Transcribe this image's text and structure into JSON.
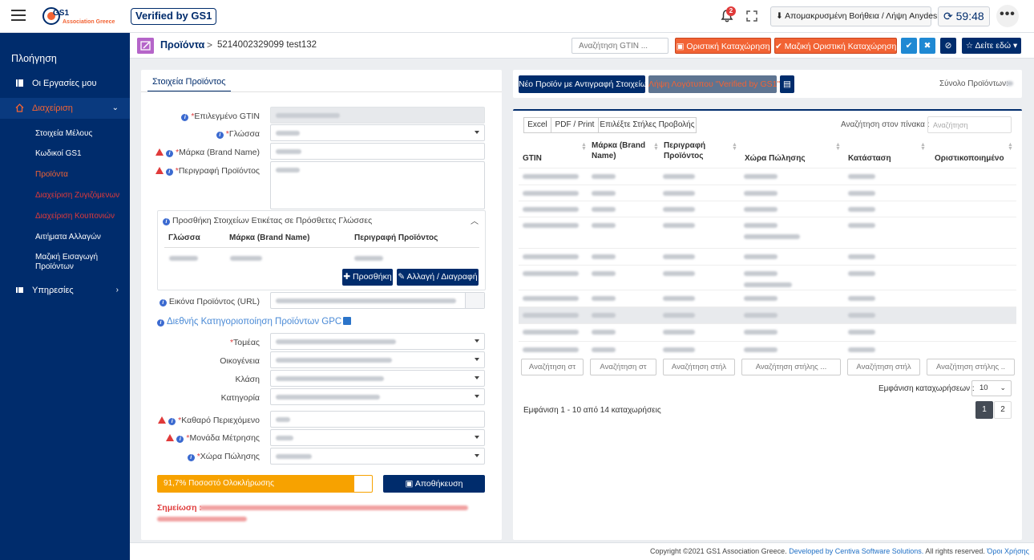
{
  "brand": {
    "logo_text": "GS1",
    "logo_sub": "Association Greece",
    "verified": "Verified by GS1"
  },
  "topbar": {
    "notif_count": "2",
    "remote_label": "Απομακρυσμένη Βοήθεια / Λήψη Anydesk",
    "timer": "59:48",
    "more": "•••"
  },
  "sidebar": {
    "title": "Πλοήγηση",
    "items": [
      {
        "label": "Οι Εργασίες μου"
      },
      {
        "label": "Διαχείριση"
      },
      {
        "label": "Υπηρεσίες"
      }
    ],
    "subitems": [
      {
        "label": "Στοιχεία Μέλους"
      },
      {
        "label": "Κωδικοί GS1"
      },
      {
        "label": "Προϊόντα"
      },
      {
        "label": "Διαχείριση Ζυγιζόμενων"
      },
      {
        "label": "Διαχείριση Κουπονιών"
      },
      {
        "label": "Αιτήματα Αλλαγών"
      },
      {
        "label": "Μαζική Εισαγωγή Προϊόντων"
      }
    ]
  },
  "header": {
    "title": "Προϊόντα",
    "crumb": "5214002329099 test132",
    "gtin_placeholder": "Αναζήτηση GTIN ...",
    "btn_final": "Οριστική Καταχώρηση",
    "btn_mass_final": "Μαζική Οριστική Καταχώρηση",
    "btn_see": "Δείτε εδώ"
  },
  "form": {
    "tab": "Στοιχεία Προϊόντος",
    "gtin_label": "Επιλεγμένο GTIN",
    "lang_label": "Γλώσσα",
    "brand_label": "Μάρκα (Brand Name)",
    "desc_label": "Περιγραφή Προϊόντος",
    "extra_title": "Προσθήκη Στοιχείων Ετικέτας σε Πρόσθετες Γλώσσες",
    "col_lang": "Γλώσσα",
    "col_brand": "Μάρκα (Brand Name)",
    "col_desc": "Περιγραφή Προϊόντος",
    "btn_add": "Προσθήκη",
    "btn_edit": "Αλλαγή / Διαγραφή",
    "image_label": "Εικόνα Προϊόντος (URL)",
    "gpc_title": "Διεθνής Κατηγοριοποίηση Προϊόντων GPC",
    "sector_label": "Τομέας",
    "family_label": "Οικογένεια",
    "class_label": "Κλάση",
    "category_label": "Κατηγορία",
    "net_label": "Καθαρό Περιεχόμενο",
    "unit_label": "Μονάδα Μέτρησης",
    "country_label": "Χώρα Πώλησης",
    "progress_text": "91,7% Ποσοστό Ολοκλήρωσης",
    "progress_value": 91.7,
    "save": "Αποθήκευση",
    "note_label": "Σημείωση :"
  },
  "right": {
    "btn_copy": "Νέο Προϊόν με Αντιγραφή Στοιχείων",
    "btn_logo": "Λήψη Λογότυπου \"Verified by GS1\"",
    "total_label": "Σύνολο Προϊόντων:",
    "excel": "Excel",
    "pdf": "PDF / Print",
    "cols_btn": "Επιλέξτε Στήλες Προβολής",
    "search_label": "Αναζήτηση στον πίνακα :",
    "search_placeholder": "Αναζήτηση",
    "headers": [
      "GTIN",
      "Μάρκα (Brand Name)",
      "Περιγραφή Προϊόντος",
      "Χώρα Πώλησης",
      "Κατάσταση",
      "Οριστικοποιημένο"
    ],
    "col_search": [
      "Αναζήτηση στ",
      "Αναζήτηση στ",
      "Αναζήτηση στήλ",
      "Αναζήτηση στήλης ...",
      "Αναζήτηση στήλ",
      "Αναζήτηση στήλης .."
    ],
    "entries_label": "Εμφάνιση καταχωρήσεων :",
    "entries_value": "10",
    "info": "Εμφάνιση 1 - 10 από 14 καταχωρήσεις",
    "pages": [
      "1",
      "2"
    ]
  },
  "footer": {
    "copyright": "Copyright ©2021 GS1 Association Greece.",
    "dev": "Developed by Centiva Software Solutions.",
    "rights": "All rights reserved.",
    "terms": "Όροι Χρήσης"
  }
}
